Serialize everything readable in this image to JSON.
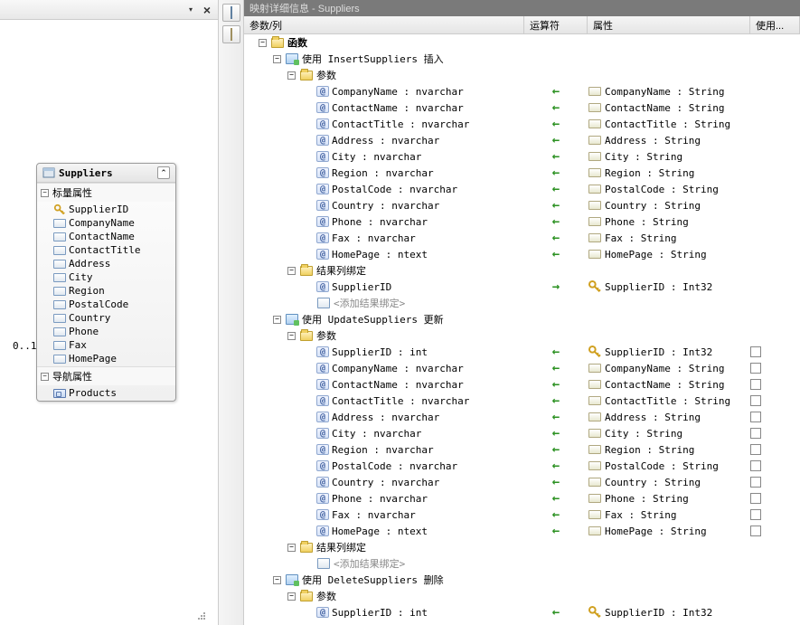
{
  "tab_title": "映射详细信息 - Suppliers",
  "relation_label": "0..1",
  "entity": {
    "name": "Suppliers",
    "section_scalar": "标量属性",
    "section_nav": "导航属性",
    "scalar_props": [
      {
        "name": "SupplierID",
        "is_key": true
      },
      {
        "name": "CompanyName",
        "is_key": false
      },
      {
        "name": "ContactName",
        "is_key": false
      },
      {
        "name": "ContactTitle",
        "is_key": false
      },
      {
        "name": "Address",
        "is_key": false
      },
      {
        "name": "City",
        "is_key": false
      },
      {
        "name": "Region",
        "is_key": false
      },
      {
        "name": "PostalCode",
        "is_key": false
      },
      {
        "name": "Country",
        "is_key": false
      },
      {
        "name": "Phone",
        "is_key": false
      },
      {
        "name": "Fax",
        "is_key": false
      },
      {
        "name": "HomePage",
        "is_key": false
      }
    ],
    "nav_props": [
      {
        "name": "Products"
      }
    ]
  },
  "grid_headers": {
    "col1": "参数/列",
    "col2": "运算符",
    "col3": "属性",
    "col4": "使用..."
  },
  "tree": {
    "root": "函数",
    "add_binding": "<添加结果绑定>",
    "sections": [
      {
        "title": "使用 InsertSuppliers 插入",
        "params_label": "参数",
        "result_label": "结果列绑定",
        "params": [
          {
            "param": "CompanyName : nvarchar",
            "dir": "left",
            "attr": "CompanyName : String",
            "key": false,
            "cb": false
          },
          {
            "param": "ContactName : nvarchar",
            "dir": "left",
            "attr": "ContactName : String",
            "key": false,
            "cb": false
          },
          {
            "param": "ContactTitle : nvarchar",
            "dir": "left",
            "attr": "ContactTitle : String",
            "key": false,
            "cb": false
          },
          {
            "param": "Address : nvarchar",
            "dir": "left",
            "attr": "Address : String",
            "key": false,
            "cb": false
          },
          {
            "param": "City : nvarchar",
            "dir": "left",
            "attr": "City : String",
            "key": false,
            "cb": false
          },
          {
            "param": "Region : nvarchar",
            "dir": "left",
            "attr": "Region : String",
            "key": false,
            "cb": false
          },
          {
            "param": "PostalCode : nvarchar",
            "dir": "left",
            "attr": "PostalCode : String",
            "key": false,
            "cb": false
          },
          {
            "param": "Country : nvarchar",
            "dir": "left",
            "attr": "Country : String",
            "key": false,
            "cb": false
          },
          {
            "param": "Phone : nvarchar",
            "dir": "left",
            "attr": "Phone : String",
            "key": false,
            "cb": false
          },
          {
            "param": "Fax : nvarchar",
            "dir": "left",
            "attr": "Fax : String",
            "key": false,
            "cb": false
          },
          {
            "param": "HomePage : ntext",
            "dir": "left",
            "attr": "HomePage : String",
            "key": false,
            "cb": false
          }
        ],
        "results": [
          {
            "param": "SupplierID",
            "dir": "right",
            "attr": "SupplierID : Int32",
            "key": true,
            "cb": false
          }
        ],
        "show_add": true
      },
      {
        "title": "使用 UpdateSuppliers 更新",
        "params_label": "参数",
        "result_label": "结果列绑定",
        "params": [
          {
            "param": "SupplierID : int",
            "dir": "left",
            "attr": "SupplierID : Int32",
            "key": true,
            "cb": true
          },
          {
            "param": "CompanyName : nvarchar",
            "dir": "left",
            "attr": "CompanyName : String",
            "key": false,
            "cb": true
          },
          {
            "param": "ContactName : nvarchar",
            "dir": "left",
            "attr": "ContactName : String",
            "key": false,
            "cb": true
          },
          {
            "param": "ContactTitle : nvarchar",
            "dir": "left",
            "attr": "ContactTitle : String",
            "key": false,
            "cb": true
          },
          {
            "param": "Address : nvarchar",
            "dir": "left",
            "attr": "Address : String",
            "key": false,
            "cb": true
          },
          {
            "param": "City : nvarchar",
            "dir": "left",
            "attr": "City : String",
            "key": false,
            "cb": true
          },
          {
            "param": "Region : nvarchar",
            "dir": "left",
            "attr": "Region : String",
            "key": false,
            "cb": true
          },
          {
            "param": "PostalCode : nvarchar",
            "dir": "left",
            "attr": "PostalCode : String",
            "key": false,
            "cb": true
          },
          {
            "param": "Country : nvarchar",
            "dir": "left",
            "attr": "Country : String",
            "key": false,
            "cb": true
          },
          {
            "param": "Phone : nvarchar",
            "dir": "left",
            "attr": "Phone : String",
            "key": false,
            "cb": true
          },
          {
            "param": "Fax : nvarchar",
            "dir": "left",
            "attr": "Fax : String",
            "key": false,
            "cb": true
          },
          {
            "param": "HomePage : ntext",
            "dir": "left",
            "attr": "HomePage : String",
            "key": false,
            "cb": true
          }
        ],
        "results": [],
        "show_add": true
      },
      {
        "title": "使用 DeleteSuppliers 删除",
        "params_label": "参数",
        "result_label": "",
        "params": [
          {
            "param": "SupplierID : int",
            "dir": "left",
            "attr": "SupplierID : Int32",
            "key": true,
            "cb": false
          }
        ],
        "results": [],
        "show_add": false
      }
    ]
  }
}
